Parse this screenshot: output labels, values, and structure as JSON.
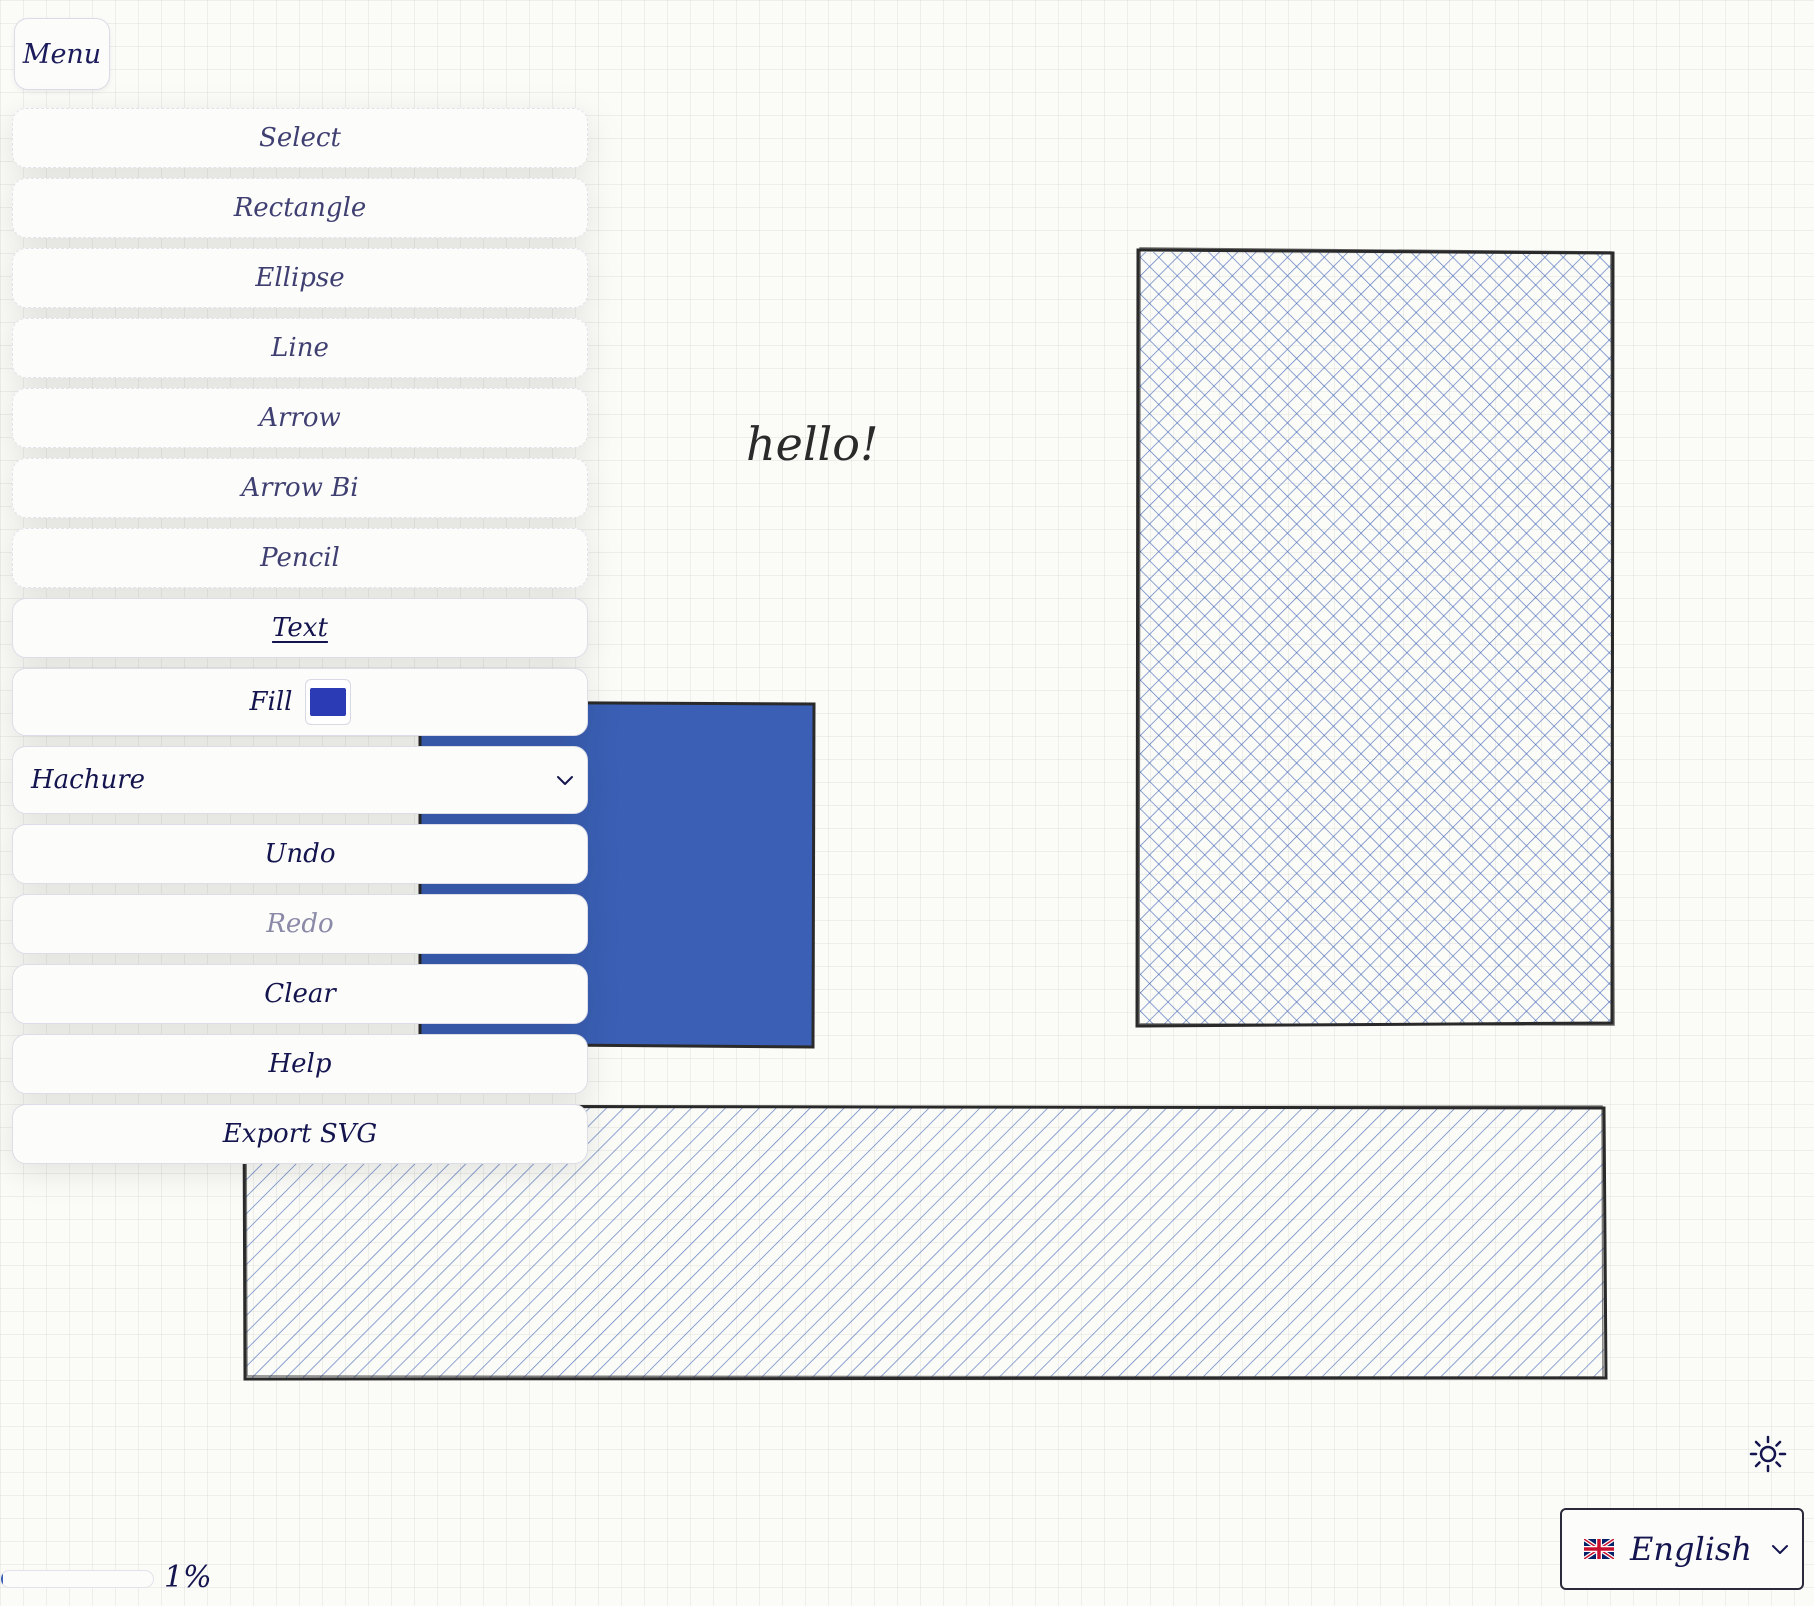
{
  "menu": {
    "label": "Menu"
  },
  "tools": [
    {
      "label": "Select"
    },
    {
      "label": "Rectangle"
    },
    {
      "label": "Ellipse"
    },
    {
      "label": "Line"
    },
    {
      "label": "Arrow"
    },
    {
      "label": "Arrow Bi"
    },
    {
      "label": "Pencil"
    },
    {
      "label": "Text",
      "active": true
    }
  ],
  "fill": {
    "label": "Fill",
    "color": "#2b3ab5"
  },
  "fill_style": {
    "selected": "Hachure"
  },
  "actions": [
    {
      "label": "Undo"
    },
    {
      "label": "Redo",
      "disabled": true
    },
    {
      "label": "Clear"
    },
    {
      "label": "Help"
    },
    {
      "label": "Export SVG"
    }
  ],
  "canvas": {
    "text": "hello!",
    "stroke_color": "#2a2a2a",
    "fill_color": "#3a5fb4"
  },
  "progress": {
    "value": 1,
    "label": "1%"
  },
  "language": {
    "selected": "English",
    "flag": "uk-flag-icon"
  },
  "theme": {
    "icon": "sun-icon"
  }
}
